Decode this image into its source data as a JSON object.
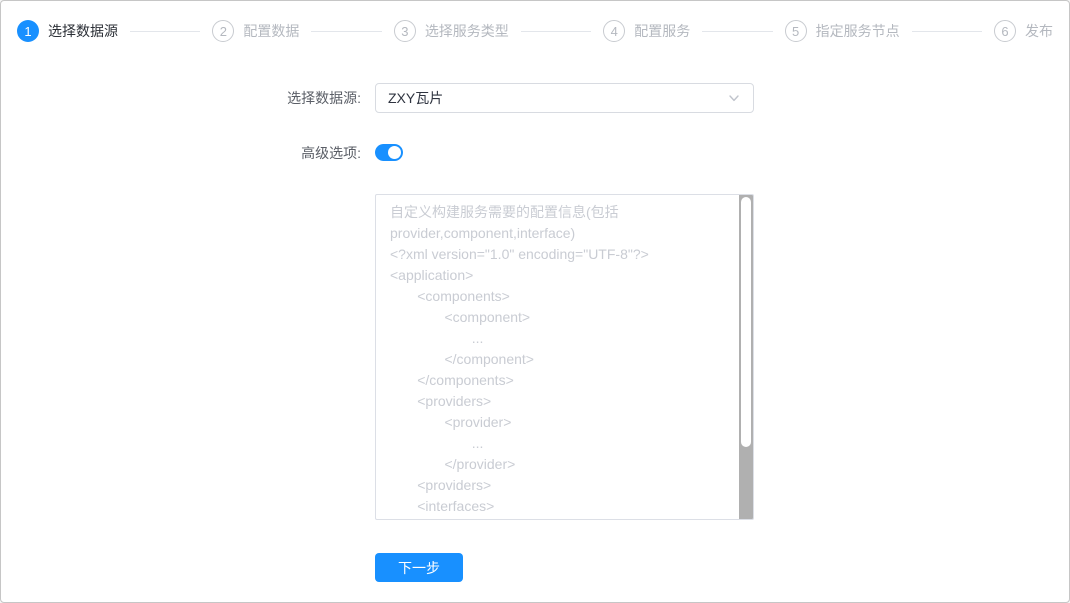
{
  "wizard": {
    "steps": [
      {
        "number": "1",
        "label": "选择数据源",
        "state": "active"
      },
      {
        "number": "2",
        "label": "配置数据",
        "state": "pending"
      },
      {
        "number": "3",
        "label": "选择服务类型",
        "state": "pending"
      },
      {
        "number": "4",
        "label": "配置服务",
        "state": "pending"
      },
      {
        "number": "5",
        "label": "指定服务节点",
        "state": "pending"
      },
      {
        "number": "6",
        "label": "发布",
        "state": "pending"
      }
    ]
  },
  "form": {
    "datasource": {
      "label": "选择数据源:",
      "value": "ZXY瓦片",
      "chevron_icon": "chevron-down"
    },
    "advanced": {
      "label": "高级选项:",
      "state": "on"
    },
    "config": {
      "placeholder": "自定义构建服务需要的配置信息(包括\nprovider,component,interface)\n<?xml version=\"1.0\" encoding=\"UTF-8\"?>\n<application>\n       <components>\n              <component>\n                     ...\n              </component>\n       </components>\n       <providers>\n              <provider>\n                     ...\n              </provider>\n       <providers>\n       <interfaces>"
    },
    "next_button_label": "下一步"
  },
  "colors": {
    "accent": "#1890ff",
    "inactive_step": "#b4b8bf",
    "placeholder_text": "#c9ccd3",
    "scroll_track": "#b0b0b0",
    "scroll_thumb": "#ffffff"
  }
}
